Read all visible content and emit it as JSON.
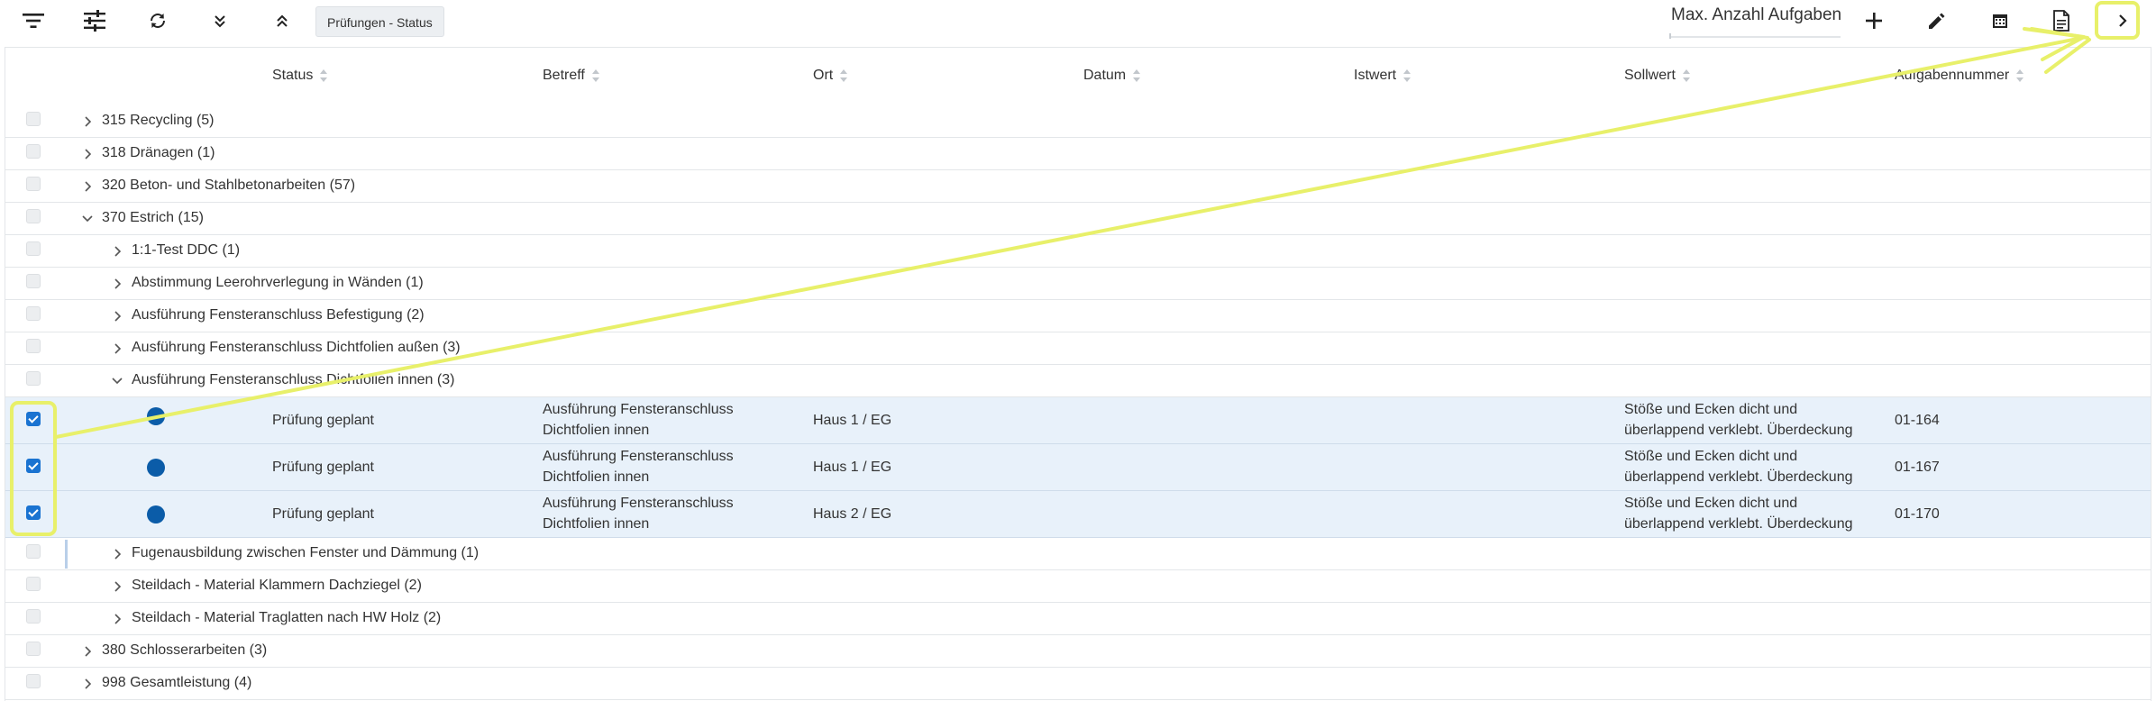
{
  "toolbar": {
    "chip_label": "Prüfungen - Status",
    "max_label": "Max. Anzahl Aufgaben",
    "icons": [
      "filter-icon",
      "tune-icon",
      "refresh-icon",
      "collapse-all-icon",
      "expand-all-icon",
      "add-icon",
      "edit-icon",
      "calendar-icon",
      "document-icon",
      "chevron-right-icon"
    ]
  },
  "columns": [
    "Status",
    "Betreff",
    "Ort",
    "Datum",
    "Istwert",
    "Sollwert",
    "Aufgabennummer"
  ],
  "groups": [
    {
      "label": "315 Recycling (5)"
    },
    {
      "label": "318 Dränagen (1)"
    },
    {
      "label": "320 Beton- und Stahlbetonarbeiten (57)"
    },
    {
      "label": "370 Estrich (15)"
    },
    {
      "label": "1:1-Test DDC (1)"
    },
    {
      "label": "Abstimmung Leerohrverlegung in Wänden (1)"
    },
    {
      "label": "Ausführung Fensteranschluss Befestigung (2)"
    },
    {
      "label": "Ausführung Fensteranschluss Dichtfolien außen (3)"
    },
    {
      "label": "Ausführung Fensteranschluss Dichtfolien innen (3)"
    },
    {
      "label": "Fugenausbildung zwischen Fenster und Dämmung (1)"
    },
    {
      "label": "Steildach - Material Klammern Dachziegel (2)"
    },
    {
      "label": "Steildach - Material Traglatten nach HW Holz (2)"
    },
    {
      "label": "380 Schlosserarbeiten (3)"
    },
    {
      "label": "998 Gesamtleistung (4)"
    }
  ],
  "data_rows": [
    {
      "status": "Prüfung geplant",
      "betreff_1": "Ausführung Fensteranschluss",
      "betreff_2": "Dichtfolien innen",
      "ort": "Haus 1 / EG",
      "soll_1": "Stöße und Ecken dicht und",
      "soll_2": "überlappend verklebt. Überdeckung",
      "nr": "01-164",
      "checked": true
    },
    {
      "status": "Prüfung geplant",
      "betreff_1": "Ausführung Fensteranschluss",
      "betreff_2": "Dichtfolien innen",
      "ort": "Haus 1 / EG",
      "soll_1": "Stöße und Ecken dicht und",
      "soll_2": "überlappend verklebt. Überdeckung",
      "nr": "01-167",
      "checked": true
    },
    {
      "status": "Prüfung geplant",
      "betreff_1": "Ausführung Fensteranschluss",
      "betreff_2": "Dichtfolien innen",
      "ort": "Haus 2 / EG",
      "soll_1": "Stöße und Ecken dicht und",
      "soll_2": "überlappend verklebt. Überdeckung",
      "nr": "01-170",
      "checked": true
    }
  ],
  "colors": {
    "accent": "#1a73d1",
    "status_dot": "#0b5ca8",
    "selected_row": "#e8f1fa",
    "annotation": "#e8f06a"
  }
}
